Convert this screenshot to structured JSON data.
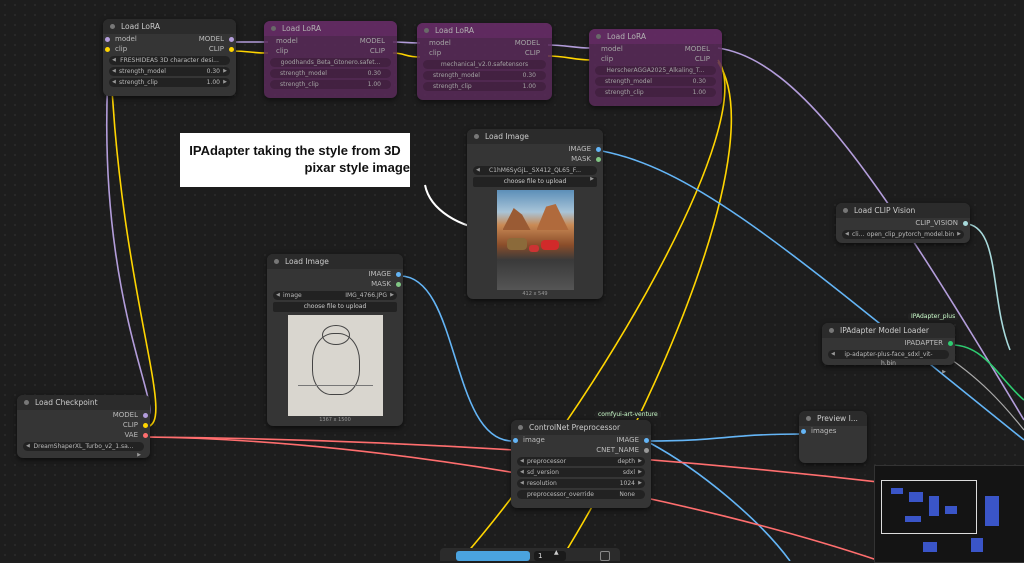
{
  "callout": {
    "line1": "IPAdapter taking the style from 3D",
    "line2": "pixar style image"
  },
  "lora1": {
    "title": "Load LoRA",
    "in_model": "model",
    "in_clip": "clip",
    "out_model": "MODEL",
    "out_clip": "CLIP",
    "lora_name": "FRESHIDEAS 3D character desi...",
    "strength_model_label": "strength_model",
    "strength_model": "0.30",
    "strength_clip_label": "strength_clip",
    "strength_clip": "1.00"
  },
  "lora2": {
    "title": "Load LoRA",
    "in_model": "model",
    "in_clip": "clip",
    "out_model": "MODEL",
    "out_clip": "CLIP",
    "lora_name": "goodhands_Beta_Gtonero.safet...",
    "strength_model_label": "strength_model",
    "strength_model": "0.30",
    "strength_clip_label": "strength_clip",
    "strength_clip": "1.00"
  },
  "lora3": {
    "title": "Load LoRA",
    "in_model": "model",
    "in_clip": "clip",
    "out_model": "MODEL",
    "out_clip": "CLIP",
    "lora_name": "mechanical_v2.0.safetensors",
    "strength_model_label": "strength_model",
    "strength_model": "0.30",
    "strength_clip_label": "strength_clip",
    "strength_clip": "1.00"
  },
  "lora4": {
    "title": "Load LoRA",
    "in_model": "model",
    "in_clip": "clip",
    "out_model": "MODEL",
    "out_clip": "CLIP",
    "lora_name": "HerscherAGGA2025_Alkaling_T...",
    "strength_model_label": "strength_model",
    "strength_model": "0.30",
    "strength_clip_label": "strength_clip",
    "strength_clip": "1.00"
  },
  "loadimage_pixar": {
    "title": "Load Image",
    "out_image": "IMAGE",
    "out_mask": "MASK",
    "file": "C1hM6SyGjL._SX412_QL65_F...",
    "upload": "choose file to upload",
    "dims": "412 x 549"
  },
  "loadimage_sketch": {
    "title": "Load Image",
    "out_image": "IMAGE",
    "out_mask": "MASK",
    "image_label": "image",
    "file": "IMG_4766.JPG",
    "upload": "choose file to upload",
    "dims": "1367 x 1500"
  },
  "checkpoint": {
    "title": "Load Checkpoint",
    "out_model": "MODEL",
    "out_clip": "CLIP",
    "out_vae": "VAE",
    "ckpt": "DreamShaperXL_Turbo_v2_1.sa..."
  },
  "clipvision": {
    "title": "Load CLIP Vision",
    "out": "CLIP_VISION",
    "file_prefix": "cli...",
    "file": "open_clip_pytorch_model.bin"
  },
  "ipadapter": {
    "badge": "IPAdapter_plus",
    "title": "IPAdapter Model Loader",
    "out": "IPADAPTER",
    "file": "ip-adapter-plus-face_sdxl_vit-h.bin"
  },
  "controlnet": {
    "badge": "comfyui-art-venture",
    "title": "ControlNet Preprocessor",
    "in_image": "image",
    "out_image": "IMAGE",
    "out_cnet": "CNET_NAME",
    "preprocessor_label": "preprocessor",
    "preprocessor": "depth",
    "sd_version_label": "sd_version",
    "sd_version": "sdxl",
    "resolution_label": "resolution",
    "resolution": "1024",
    "override_label": "preprocessor_override",
    "override": "None"
  },
  "preview": {
    "title": "Preview I...",
    "in_images": "images"
  },
  "toolbar": {
    "count": "1"
  },
  "colors": {
    "model": "#b39ddb",
    "clip": "#ffd500",
    "image": "#64b5f6",
    "vae": "#ff6e6e",
    "clip_vision": "#a8dadc",
    "ipadapter": "#2ecc71"
  }
}
